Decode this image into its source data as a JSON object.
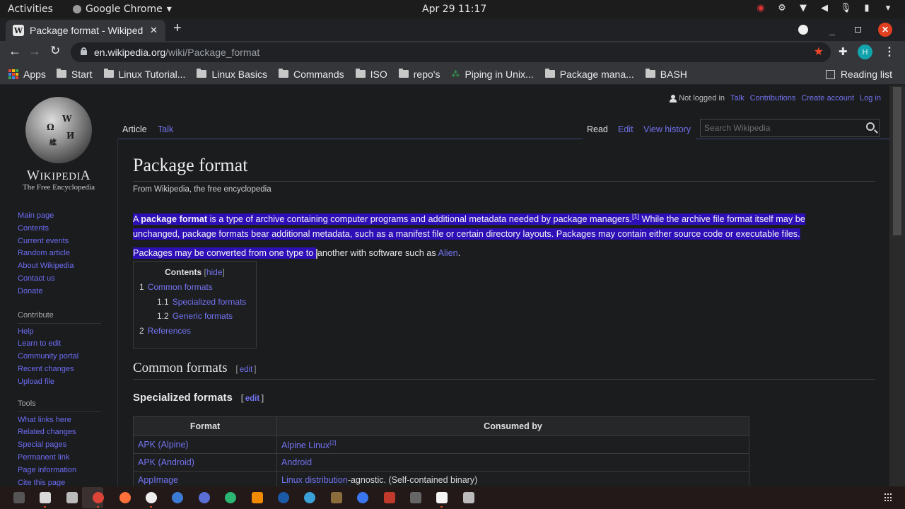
{
  "system": {
    "activities": "Activities",
    "app_name": "Google Chrome",
    "clock": "Apr 29  11:17",
    "tray_icons": [
      "screen-record-icon",
      "steam-icon",
      "wifi-icon",
      "volume-icon",
      "microphone-icon",
      "battery-icon",
      "system-menu-arrow-icon"
    ]
  },
  "browser": {
    "tab_title": "Package format - Wikipedia",
    "tab_favicon": "W",
    "new_tab": "+",
    "tab_close": "✕",
    "url_host": "en.wikipedia.org",
    "url_path": "/wiki/Package_format",
    "profile_initial": "H",
    "colors": {
      "close_button": "#e0401f",
      "bookmark_star": "#f44727",
      "profile": "#12a4ad"
    },
    "bookmarks": [
      {
        "label": "Apps",
        "icon": "apps-grid-icon"
      },
      {
        "label": "Start",
        "icon": "folder-icon"
      },
      {
        "label": "Linux Tutorial...",
        "icon": "folder-icon"
      },
      {
        "label": "Linux Basics",
        "icon": "folder-icon"
      },
      {
        "label": "Commands",
        "icon": "folder-icon"
      },
      {
        "label": "ISO",
        "icon": "folder-icon"
      },
      {
        "label": "repo's",
        "icon": "folder-icon"
      },
      {
        "label": "Piping in Unix...",
        "icon": "site-favicon"
      },
      {
        "label": "Package mana...",
        "icon": "folder-icon"
      },
      {
        "label": "BASH",
        "icon": "folder-icon"
      }
    ],
    "reading_list": "Reading list"
  },
  "wiki": {
    "logo_word": "Wikipedia",
    "logo_tagline": "The Free Encyclopedia",
    "personal": {
      "not_logged_in": "Not logged in",
      "links": [
        "Talk",
        "Contributions",
        "Create account",
        "Log in"
      ]
    },
    "tabs": {
      "article": "Article",
      "talk": "Talk",
      "read": "Read",
      "edit": "Edit",
      "view_history": "View history"
    },
    "search_placeholder": "Search Wikipedia",
    "nav_main": [
      "Main page",
      "Contents",
      "Current events",
      "Random article",
      "About Wikipedia",
      "Contact us",
      "Donate"
    ],
    "nav_contribute_title": "Contribute",
    "nav_contribute": [
      "Help",
      "Learn to edit",
      "Community portal",
      "Recent changes",
      "Upload file"
    ],
    "nav_tools_title": "Tools",
    "nav_tools": [
      "What links here",
      "Related changes",
      "Special pages",
      "Permanent link",
      "Page information",
      "Cite this page"
    ],
    "title": "Package format",
    "from": "From Wikipedia, the free encyclopedia",
    "lead": {
      "p1_a": "A ",
      "p1_bold": "package format",
      "p1_b": " is a type of archive containing computer programs and additional metadata needed by package managers.",
      "p1_ref": "[1]",
      "p1_c": " While the archive file format itself may be unchanged, package formats bear additional metadata, such as a manifest file or certain directory layouts. Packages may contain either source code or executable files.",
      "p2_selected": "Packages may be converted from one type to ",
      "p2_rest": "another with software such as ",
      "p2_link": "Alien",
      "p2_end": "."
    },
    "selection_color": "#2e0fb7",
    "toc": {
      "title": "Contents",
      "hide": "hide",
      "items": [
        {
          "num": "1",
          "label": "Common formats",
          "level": 1
        },
        {
          "num": "1.1",
          "label": "Specialized formats",
          "level": 2
        },
        {
          "num": "1.2",
          "label": "Generic formats",
          "level": 2
        },
        {
          "num": "2",
          "label": "References",
          "level": 1
        }
      ]
    },
    "h2": "Common formats",
    "h3": "Specialized formats",
    "edit_label": "edit",
    "table": {
      "headers": [
        "Format",
        "Consumed by"
      ],
      "rows": [
        {
          "format": "APK (Alpine)",
          "consumer_link": "Alpine Linux",
          "consumer_ref": "[2]",
          "consumer_text": ""
        },
        {
          "format": "APK (Android)",
          "consumer_link": "Android",
          "consumer_ref": "",
          "consumer_text": ""
        },
        {
          "format": "AppImage",
          "consumer_link": "Linux distribution",
          "consumer_ref": "",
          "consumer_text": "-agnostic. (Self-contained binary)"
        }
      ]
    }
  },
  "dock": {
    "apps": [
      "terminal-icon",
      "files-icon",
      "disks-icon",
      "chrome-icon",
      "firefox-icon",
      "obs-icon",
      "vscode-icon",
      "keepass-icon",
      "vim-icon",
      "vlc-icon",
      "steam-icon",
      "telegram-icon",
      "gimp-icon",
      "signal-icon",
      "anydesk-icon",
      "terminal2-icon",
      "text-editor-icon",
      "trash-icon"
    ],
    "show_apps": "show-applications-icon"
  }
}
